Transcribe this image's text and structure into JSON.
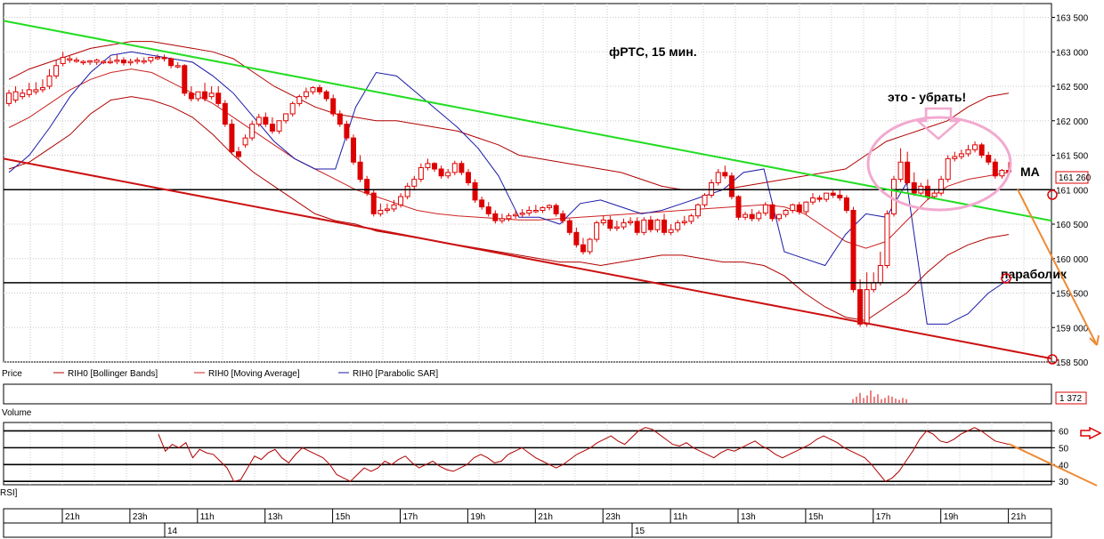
{
  "chart_data": [
    {
      "type": "candlestick",
      "title": "фРТС,  15 мин.",
      "y_ticks": [
        "163 500",
        "163 000",
        "162 500",
        "162 000",
        "161 500",
        "161 000",
        "160 500",
        "160 000",
        "159 500",
        "159 000",
        "158 500"
      ],
      "ylim": [
        158500,
        163700
      ],
      "last_price_label": "161 260",
      "grid": true,
      "legend_label": "Price",
      "legend": [
        "RIH0 [Bollinger Bands]",
        "RIH0 [Moving Average]",
        "RIH0 [Parabolic SAR]"
      ],
      "candles": [
        [
          162250,
          162450,
          162400
        ],
        [
          162300,
          162500,
          162420
        ],
        [
          162350,
          162460,
          162400
        ],
        [
          162380,
          162550,
          162450
        ],
        [
          162420,
          162560,
          162450
        ],
        [
          162450,
          162600,
          162480
        ],
        [
          162500,
          162750,
          162650
        ],
        [
          162650,
          162880,
          162800
        ],
        [
          162830,
          163000,
          162920
        ],
        [
          162880,
          162950,
          162900
        ],
        [
          162880,
          162920,
          162880
        ],
        [
          162850,
          162880,
          162860
        ],
        [
          162850,
          162880,
          162870
        ],
        [
          162850,
          162900,
          162880
        ],
        [
          162860,
          162880,
          162860
        ],
        [
          162860,
          162920,
          162860
        ],
        [
          162860,
          162960,
          162880
        ],
        [
          162880,
          162920,
          162840
        ],
        [
          162840,
          162900,
          162860
        ],
        [
          162860,
          162920,
          162880
        ],
        [
          162860,
          162920,
          162870
        ],
        [
          162870,
          162920,
          162920
        ],
        [
          162920,
          162960,
          162920
        ],
        [
          162920,
          162960,
          162900
        ],
        [
          162900,
          162920,
          162800
        ],
        [
          162800,
          162850,
          162800
        ],
        [
          162800,
          162820,
          162400
        ],
        [
          162400,
          162500,
          162320
        ],
        [
          162320,
          162400,
          162420
        ],
        [
          162420,
          162550,
          162320
        ],
        [
          162350,
          162500,
          162400
        ],
        [
          162400,
          162500,
          162250
        ],
        [
          162250,
          162300,
          161950
        ],
        [
          161950,
          162020,
          161550
        ],
        [
          161550,
          161620,
          161480
        ],
        [
          161650,
          161800,
          161750
        ],
        [
          161750,
          162000,
          161950
        ],
        [
          161950,
          162100,
          162050
        ],
        [
          162050,
          162120,
          161950
        ],
        [
          161950,
          162050,
          161850
        ],
        [
          161850,
          162000,
          162000
        ],
        [
          162000,
          162100,
          162100
        ],
        [
          162100,
          162280,
          162250
        ],
        [
          162250,
          162380,
          162350
        ],
        [
          162350,
          162480,
          162420
        ],
        [
          162420,
          162500,
          162480
        ],
        [
          162480,
          162520,
          162420
        ],
        [
          162420,
          162450,
          162320
        ],
        [
          162320,
          162380,
          162100
        ],
        [
          162100,
          162150,
          161950
        ],
        [
          161950,
          162000,
          161750
        ],
        [
          161750,
          161800,
          161400
        ],
        [
          161400,
          161500,
          161150
        ],
        [
          161150,
          161200,
          160950
        ],
        [
          160950,
          161000,
          160650
        ],
        [
          160650,
          160800,
          160700
        ],
        [
          160700,
          160800,
          160720
        ],
        [
          160720,
          160850,
          160780
        ],
        [
          160780,
          160950,
          160900
        ],
        [
          160900,
          161100,
          161050
        ],
        [
          161050,
          161200,
          161150
        ],
        [
          161150,
          161380,
          161320
        ],
        [
          161320,
          161450,
          161380
        ],
        [
          161380,
          161400,
          161300
        ],
        [
          161300,
          161350,
          161200
        ],
        [
          161200,
          161300,
          161250
        ],
        [
          161250,
          161420,
          161380
        ],
        [
          161380,
          161420,
          161250
        ],
        [
          161250,
          161300,
          161100
        ],
        [
          161100,
          161150,
          160850
        ],
        [
          160850,
          160900,
          160750
        ],
        [
          160750,
          160820,
          160650
        ],
        [
          160650,
          160700,
          160550
        ],
        [
          160550,
          160650,
          160580
        ],
        [
          160580,
          160660,
          160620
        ],
        [
          160620,
          160700,
          160640
        ],
        [
          160640,
          160720,
          160660
        ],
        [
          160660,
          160760,
          160700
        ],
        [
          160700,
          160780,
          160700
        ],
        [
          160700,
          160760,
          160740
        ],
        [
          160740,
          160790,
          160770
        ],
        [
          160770,
          160800,
          160650
        ],
        [
          160650,
          160700,
          160550
        ],
        [
          160550,
          160580,
          160380
        ],
        [
          160380,
          160450,
          160200
        ],
        [
          160200,
          160300,
          160100
        ],
        [
          160100,
          160300,
          160280
        ],
        [
          160280,
          160550,
          160520
        ],
        [
          160520,
          160620,
          160560
        ],
        [
          160560,
          160620,
          160440
        ],
        [
          160440,
          160550,
          160460
        ],
        [
          160460,
          160580,
          160520
        ],
        [
          160520,
          160600,
          160540
        ],
        [
          160540,
          160600,
          160380
        ],
        [
          160380,
          160600,
          160560
        ],
        [
          160560,
          160620,
          160420
        ],
        [
          160420,
          160580,
          160560
        ],
        [
          160560,
          160650,
          160380
        ],
        [
          160380,
          160500,
          160420
        ],
        [
          160420,
          160560,
          160520
        ],
        [
          160520,
          160620,
          160540
        ],
        [
          160540,
          160650,
          160620
        ],
        [
          160620,
          160800,
          160780
        ],
        [
          160780,
          160950,
          160920
        ],
        [
          160920,
          161150,
          161100
        ],
        [
          161100,
          161300,
          161250
        ],
        [
          161250,
          161350,
          161200
        ],
        [
          161200,
          161250,
          160900
        ],
        [
          160900,
          160920,
          160600
        ],
        [
          160600,
          160680,
          160640
        ],
        [
          160640,
          160720,
          160580
        ],
        [
          160580,
          160700,
          160660
        ],
        [
          160660,
          160820,
          160780
        ],
        [
          160780,
          160820,
          160580
        ],
        [
          160580,
          160650,
          160640
        ],
        [
          160640,
          160720,
          160700
        ],
        [
          160700,
          160800,
          160780
        ],
        [
          160780,
          160820,
          160680
        ],
        [
          160680,
          160830,
          160820
        ],
        [
          160820,
          160950,
          160880
        ],
        [
          160880,
          160920,
          160860
        ],
        [
          160860,
          160950,
          160950
        ],
        [
          160950,
          161000,
          160920
        ],
        [
          160920,
          161000,
          160880
        ],
        [
          160880,
          160920,
          160700
        ],
        [
          160700,
          160750,
          159550
        ],
        [
          159550,
          159700,
          159050
        ],
        [
          159050,
          159800,
          159550
        ],
        [
          159550,
          159800,
          159650
        ],
        [
          159650,
          160100,
          159900
        ],
        [
          159900,
          160700,
          160650
        ],
        [
          160650,
          161200,
          161150
        ],
        [
          161150,
          161600,
          161400
        ],
        [
          161400,
          161550,
          161100
        ],
        [
          161100,
          161250,
          160950
        ],
        [
          160950,
          161100,
          161050
        ],
        [
          161050,
          161150,
          160900
        ],
        [
          160900,
          161000,
          160950
        ],
        [
          160950,
          161200,
          161150
        ],
        [
          161150,
          161500,
          161450
        ],
        [
          161450,
          161550,
          161480
        ],
        [
          161480,
          161580,
          161520
        ],
        [
          161520,
          161650,
          161580
        ],
        [
          161580,
          161700,
          161650
        ],
        [
          161650,
          161680,
          161500
        ],
        [
          161500,
          161550,
          161400
        ],
        [
          161400,
          161450,
          161200
        ],
        [
          161200,
          161300,
          161280
        ],
        [
          161280,
          161400,
          161260
        ]
      ],
      "bollinger_upper": [
        162600,
        162750,
        162850,
        162950,
        163050,
        163100,
        163150,
        163150,
        163100,
        163050,
        163000,
        162900,
        162700,
        162500,
        162350,
        162200,
        162100,
        162050,
        162000,
        162000,
        161950,
        161900,
        161850,
        161750,
        161650,
        161500,
        161450,
        161400,
        161350,
        161300,
        161250,
        161150,
        161050,
        161000,
        161000,
        161000,
        161050,
        161100,
        161150,
        161200,
        161250,
        161300,
        161500,
        161700,
        161800,
        161900,
        162000,
        162200,
        162350,
        162400
      ],
      "bollinger_lower": [
        161300,
        161400,
        161600,
        161800,
        162100,
        162300,
        162350,
        162300,
        162200,
        162050,
        161800,
        161500,
        161250,
        161050,
        160850,
        160650,
        160550,
        160500,
        160400,
        160350,
        160300,
        160250,
        160200,
        160150,
        160100,
        160050,
        160000,
        159950,
        159950,
        159900,
        159950,
        160000,
        160050,
        160050,
        160000,
        159950,
        159950,
        159900,
        159750,
        159500,
        159300,
        159150,
        159100,
        159300,
        159500,
        159800,
        160050,
        160200,
        160300,
        160350
      ],
      "moving_average": [
        161900,
        162050,
        162250,
        162450,
        162600,
        162700,
        162750,
        162700,
        162550,
        162400,
        162250,
        162050,
        161850,
        161650,
        161450,
        161300,
        161150,
        161000,
        160900,
        160800,
        160700,
        160650,
        160620,
        160600,
        160580,
        160560,
        160560,
        160580,
        160600,
        160620,
        160640,
        160660,
        160680,
        160700,
        160720,
        160740,
        160760,
        160780,
        160750,
        160650,
        160450,
        160250,
        160150,
        160250,
        160550,
        160850,
        161050,
        161150,
        161200,
        161250
      ],
      "parabolic_sar": [
        161250,
        161500,
        161900,
        162350,
        162700,
        162950,
        163000,
        162950,
        162900,
        162850,
        162650,
        162400,
        162050,
        161700,
        161450,
        161300,
        161300,
        162200,
        162700,
        162650,
        162400,
        162150,
        161900,
        161600,
        161200,
        160600,
        160600,
        160500,
        160800,
        160850,
        160750,
        160650,
        160700,
        160800,
        160900,
        161000,
        161250,
        161300,
        160100,
        160000,
        159900,
        160350,
        160650,
        160600,
        161100,
        159050,
        159050,
        159200,
        159500,
        159700
      ],
      "channel_green": {
        "start": 163450,
        "end": 160550
      },
      "channel_red": {
        "start": 161450,
        "end": 158550
      },
      "horizontal_levels": [
        161000,
        159650
      ],
      "marked_levels": [
        161000,
        158550
      ]
    },
    {
      "type": "bar",
      "label": "Volume",
      "last_value_label": "1 372",
      "spikes": [
        0.3,
        0.5,
        0.8,
        0.4,
        0.6,
        1.0,
        0.5,
        0.7,
        0.3,
        0.4,
        0.6,
        0.5,
        0.35,
        0.25,
        0.4,
        0.3
      ]
    },
    {
      "type": "line",
      "label": "RSI]",
      "y_ticks": [
        "60",
        "50",
        "40",
        "30"
      ],
      "ylim": [
        28,
        65
      ],
      "levels": [
        60,
        50,
        40,
        30
      ],
      "values": [
        58,
        48,
        52,
        50,
        53,
        44,
        49,
        47,
        46,
        42,
        38,
        30,
        31,
        38,
        45,
        43,
        47,
        49,
        44,
        41,
        46,
        50,
        48,
        46,
        44,
        40,
        34,
        32,
        30,
        34,
        38,
        36,
        38,
        42,
        40,
        43,
        45,
        41,
        38,
        40,
        42,
        39,
        37,
        36,
        38,
        40,
        44,
        46,
        44,
        41,
        42,
        46,
        48,
        50,
        47,
        44,
        42,
        40,
        38,
        40,
        43,
        46,
        48,
        50,
        53,
        55,
        57,
        54,
        52,
        56,
        60,
        62,
        61,
        58,
        55,
        52,
        51,
        53,
        50,
        48,
        46,
        44,
        47,
        49,
        48,
        50,
        52,
        54,
        51,
        49,
        46,
        44,
        46,
        48,
        50,
        52,
        55,
        57,
        55,
        53,
        50,
        48,
        46,
        44,
        40,
        35,
        30,
        32,
        36,
        42,
        48,
        55,
        60,
        58,
        54,
        53,
        55,
        58,
        60,
        62,
        60,
        57,
        54,
        53,
        52
      ]
    }
  ],
  "annotations": {
    "remove_text": "это - убрать!",
    "ma_text": "MA",
    "parabolic_text": "параболик"
  },
  "time_axis": {
    "hours": [
      "21h",
      "23h",
      "11h",
      "13h",
      "15h",
      "17h",
      "19h",
      "21h",
      "23h",
      "11h",
      "13h",
      "15h",
      "17h",
      "19h",
      "21h"
    ],
    "dates": [
      "14",
      "15"
    ]
  },
  "colors": {
    "candle": "#dd0000",
    "bollinger": "#b00000",
    "moving_average": "#cc2222",
    "parabolic_sar": "#1a1aa8",
    "green_line": "#22dd22",
    "red_channel": "#cc1111",
    "level_line": "#000000",
    "ellipse": "#f2a9cf",
    "orange": "#ee8a33",
    "grid": "#c8c8c8"
  }
}
